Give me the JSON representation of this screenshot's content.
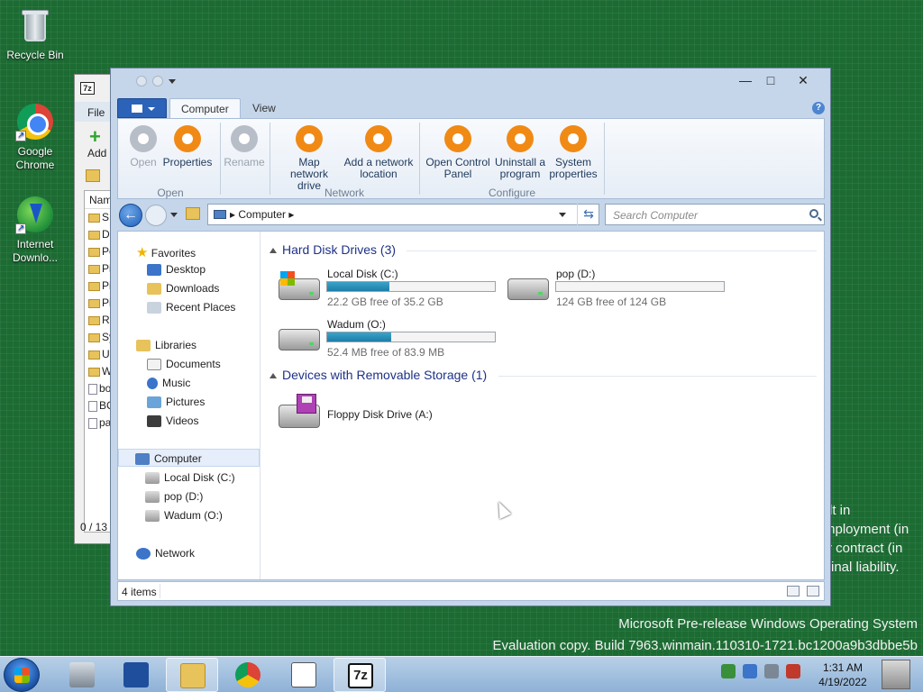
{
  "desktop": {
    "icons": [
      {
        "label": "Recycle Bin"
      },
      {
        "label": "Google Chrome"
      },
      {
        "label": "Internet Downlo..."
      }
    ],
    "legal_lines": [
      "lt in",
      "mployment (in",
      "r contract (in",
      "inal liability."
    ],
    "watermark_line1": "Microsoft Pre-release Windows Operating System",
    "watermark_line2": "Evaluation copy. Build 7963.winmain.110310-1721.bc1200a9b3dbbe5b"
  },
  "seven_zip_window": {
    "file_menu": "File",
    "add_label": "Add",
    "list_header": "Nam",
    "rows": [
      {
        "type": "folder",
        "text": "SF"
      },
      {
        "type": "folder",
        "text": "D"
      },
      {
        "type": "folder",
        "text": "Pe"
      },
      {
        "type": "folder",
        "text": "Pi"
      },
      {
        "type": "folder",
        "text": "Pi"
      },
      {
        "type": "folder",
        "text": "Pi"
      },
      {
        "type": "folder",
        "text": "Re"
      },
      {
        "type": "folder",
        "text": "Sy"
      },
      {
        "type": "folder",
        "text": "U"
      },
      {
        "type": "folder",
        "text": "W"
      },
      {
        "type": "file",
        "text": "bo"
      },
      {
        "type": "file",
        "text": "BC"
      },
      {
        "type": "file",
        "text": "pa"
      }
    ],
    "status": "0 / 13"
  },
  "explorer": {
    "tabs": {
      "computer": "Computer",
      "view": "View"
    },
    "help": "?",
    "ribbon": {
      "open": "Open",
      "properties": "Properties",
      "rename": "Rename",
      "map_network_drive": "Map network drive",
      "add_network_location": "Add a network location",
      "open_control_panel": "Open Control Panel",
      "uninstall_program": "Uninstall a program",
      "system_properties": "System properties",
      "group_open": "Open",
      "group_network": "Network",
      "group_configure": "Configure"
    },
    "address": {
      "crumb": "Computer"
    },
    "search_placeholder": "Search Computer",
    "nav": {
      "favorites": "Favorites",
      "desktop": "Desktop",
      "downloads": "Downloads",
      "recent_places": "Recent Places",
      "libraries": "Libraries",
      "documents": "Documents",
      "music": "Music",
      "pictures": "Pictures",
      "videos": "Videos",
      "computer": "Computer",
      "local_disk": "Local Disk (C:)",
      "pop": "pop (D:)",
      "wadum": "Wadum (O:)",
      "network": "Network"
    },
    "groups": {
      "hard_disks": "Hard Disk Drives (3)",
      "removable": "Devices with Removable Storage (1)"
    },
    "drives": [
      {
        "name": "Local Disk (C:)",
        "free": "22.2 GB free of 35.2 GB",
        "used_fraction": 0.37
      },
      {
        "name": "pop (D:)",
        "free": "124 GB free of 124 GB",
        "used_fraction": 0.0
      },
      {
        "name": "Wadum (O:)",
        "free": "52.4 MB free of 83.9 MB",
        "used_fraction": 0.38
      }
    ],
    "floppy": {
      "name": "Floppy Disk Drive (A:)"
    },
    "status": {
      "items": "4 items"
    }
  },
  "taskbar": {
    "clock_time": "1:31 AM",
    "clock_date": "4/19/2022",
    "seven_zip_label": "7z"
  },
  "colors": {
    "accent": "#2c62b8",
    "ribbon_orange": "#f08a15",
    "bar_fill": "#1c7ea8"
  }
}
